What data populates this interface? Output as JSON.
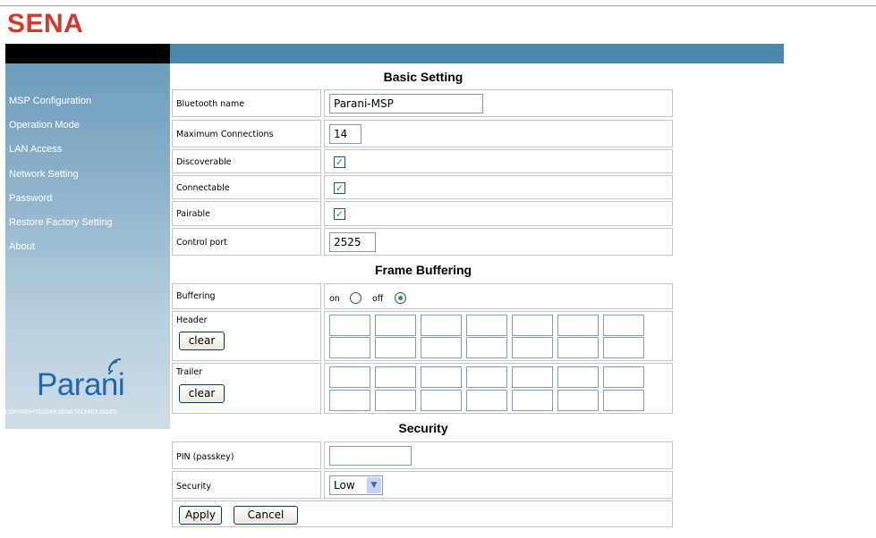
{
  "brand": {
    "name": "SENA",
    "color": "#d3392d"
  },
  "sidebar": {
    "items": [
      {
        "label": "MSP Configuration"
      },
      {
        "label": "Operation Mode"
      },
      {
        "label": "LAN Access"
      },
      {
        "label": "Network Setting"
      },
      {
        "label": "Password"
      },
      {
        "label": "Restore Factory Setting"
      },
      {
        "label": "About"
      }
    ],
    "logo": "Parani",
    "copyright": "COPYRIGHT(C)2006 SENA TECHNOLOGIES"
  },
  "basic": {
    "title": "Basic Setting",
    "bluetooth_name_label": "Bluetooth name",
    "bluetooth_name_value": "Parani-MSP",
    "max_conn_label": "Maximum Connections",
    "max_conn_value": "14",
    "discoverable_label": "Discoverable",
    "discoverable_checked": true,
    "connectable_label": "Connectable",
    "connectable_checked": true,
    "pairable_label": "Pairable",
    "pairable_checked": true,
    "control_port_label": "Control port",
    "control_port_value": "2525"
  },
  "frame": {
    "title": "Frame Buffering",
    "buffering_label": "Buffering",
    "on_label": "on",
    "off_label": "off",
    "selected": "off",
    "header_label": "Header",
    "trailer_label": "Trailer",
    "clear_label": "clear",
    "header_cells": [
      "",
      "",
      "",
      "",
      "",
      "",
      "",
      "",
      "",
      "",
      "",
      "",
      "",
      ""
    ],
    "trailer_cells": [
      "",
      "",
      "",
      "",
      "",
      "",
      "",
      "",
      "",
      "",
      "",
      "",
      "",
      ""
    ]
  },
  "security": {
    "title": "Security",
    "pin_label": "PIN (passkey)",
    "pin_value": "",
    "security_label": "Security",
    "security_value": "Low"
  },
  "actions": {
    "apply_label": "Apply",
    "cancel_label": "Cancel"
  },
  "colors": {
    "header_blue": "#4b86ab",
    "logo_blue": "#1f67ae",
    "check_green": "#21a121"
  }
}
